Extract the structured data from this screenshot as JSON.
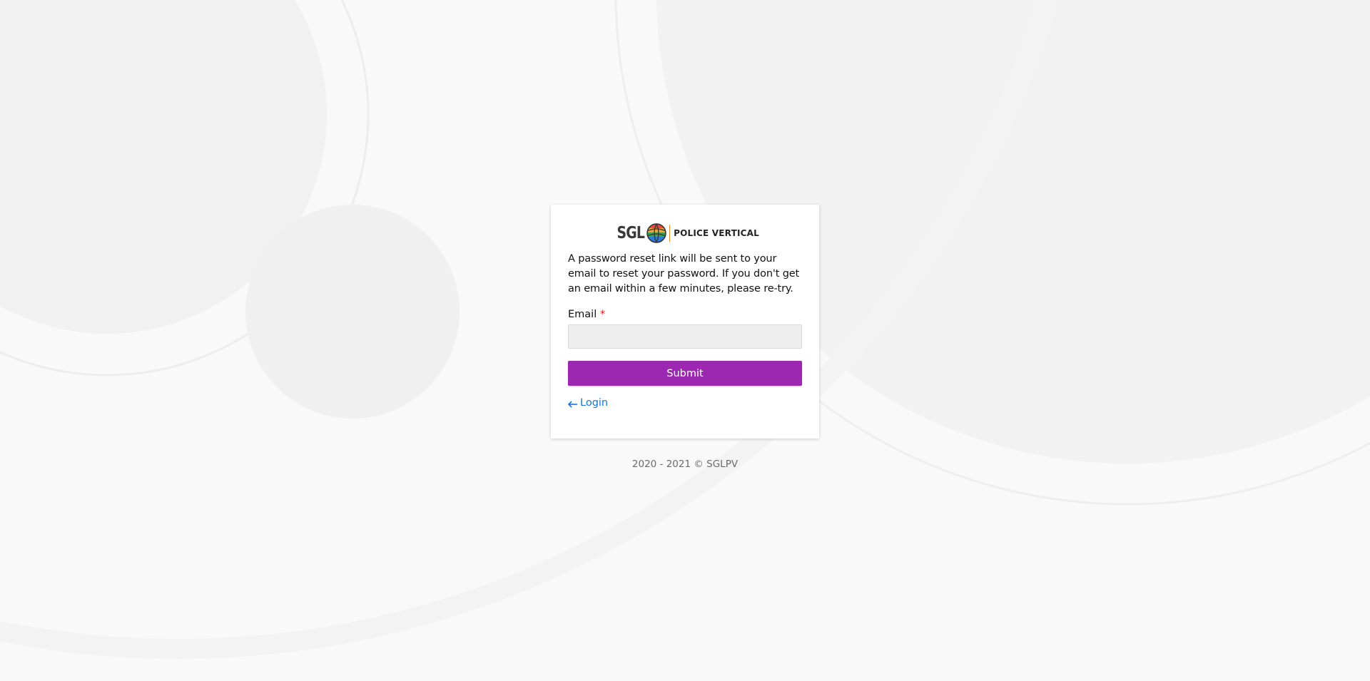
{
  "brand": {
    "logo_text": "SGL",
    "subtitle": "POLICE VERTICAL",
    "globe_icon": "globe-icon",
    "accent": "#f08a24"
  },
  "form": {
    "intro": "A password reset link will be sent to your email to reset your password. If you don't get an email within a few minutes, please re-try.",
    "email_label": "Email",
    "required_marker": "*",
    "email_value": "",
    "submit_label": "Submit",
    "submit_color": "#9c27b0"
  },
  "nav": {
    "login_label": "Login",
    "login_icon": "arrow-left-icon",
    "link_color": "#1976d2"
  },
  "footer": {
    "text": "2020 - 2021 © SGLPV"
  }
}
